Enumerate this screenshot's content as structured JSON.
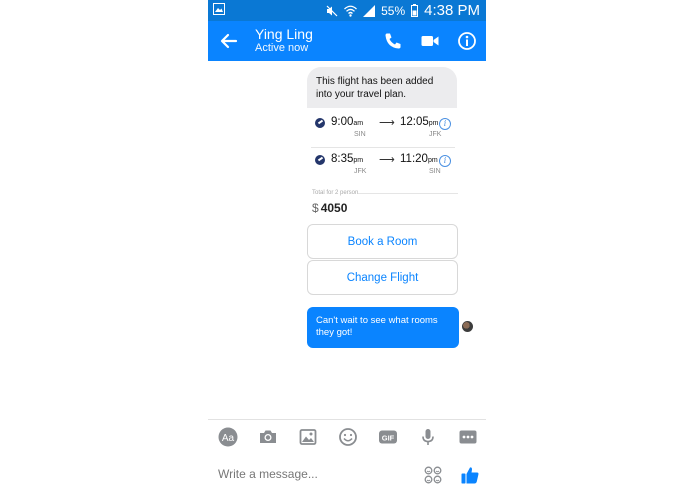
{
  "status": {
    "battery": "55%",
    "time": "4:38 PM"
  },
  "header": {
    "name": "Ying Ling",
    "status": "Active now"
  },
  "card": {
    "message_line1": "This flight has been added",
    "message_line2": "into your travel plan.",
    "legs": [
      {
        "dep_time": "9:00",
        "dep_ampm": "am",
        "arr_time": "12:05",
        "arr_ampm": "pm",
        "from": "SIN",
        "to": "JFK",
        "arrow": "⟶"
      },
      {
        "dep_time": "8:35",
        "dep_ampm": "pm",
        "arr_time": "11:20",
        "arr_ampm": "pm",
        "from": "JFK",
        "to": "SIN",
        "arrow": "⟶"
      }
    ],
    "total_label": "Total for 2 person",
    "currency": "$",
    "total": "4050"
  },
  "buttons": {
    "book_room": "Book a Room",
    "change_flight": "Change Flight"
  },
  "outgoing": {
    "line1": "Can't wait to see what rooms",
    "line2": "they got!"
  },
  "composer": {
    "placeholder": "Write a message...",
    "aa_label": "Aa",
    "gif_label": "GIF"
  },
  "colors": {
    "messenger_blue": "#0a84ff",
    "status_bar": "#0a78d4",
    "bubble_gray": "#ececee"
  }
}
